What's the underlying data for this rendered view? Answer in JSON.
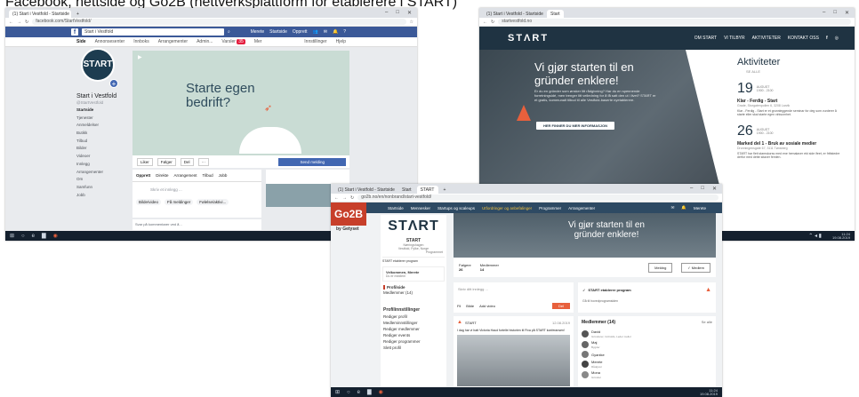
{
  "caption": "Facebook, nettside og Go2B (nettverksplattform for etablerere i START)",
  "fb": {
    "tab_title": "(1) Start i Vestfold - Startside",
    "url": "facebook.com/StartVestfold/",
    "search_value": "Start i Vestfold",
    "nav_right": [
      "Merete",
      "Startside",
      "Opprett"
    ],
    "tabs": [
      "Side",
      "Annonsesenter",
      "Innboks",
      "Arrangementer",
      "Admin...",
      "Varsler",
      "Mer"
    ],
    "tabs_right": [
      "Innstillinger",
      "Hjelp"
    ],
    "notif_count": "35",
    "page_name": "Start i Vestfold",
    "page_handle": "@StartVestfold",
    "profile_text": "STΛRT",
    "side_items": [
      "Startside",
      "Tjenester",
      "Anmeldelser",
      "Butikk",
      "Tilbud",
      "Bilder",
      "Videoer",
      "Innlegg",
      "Arrangementer",
      "Om",
      "Samfunn",
      "Jobb"
    ],
    "cover_title": "Starte egen bedrift?",
    "actions": [
      "Liker",
      "Følger",
      "Del"
    ],
    "send_msg": "Send melding",
    "composer": [
      "Opprett",
      "Direkte",
      "Arrangement",
      "Tilbud",
      "Jobb"
    ],
    "write_post": "Skriv et innlegg ...",
    "post_chips": [
      "Bilde/video",
      "Få meldinger",
      "Følelse/aktivi..."
    ],
    "reply_note": "Svar på kommentarer ved å..."
  },
  "start_web": {
    "tab_title": "Start",
    "url": "startvestfold.no",
    "logo": "STΛRT",
    "nav": [
      "OM START",
      "VI TILBYR",
      "AKTIVITETER",
      "KONTAKT OSS"
    ],
    "hero_title": "Vi gjør starten til en gründer enklere!",
    "hero_text": "Er du en gründer som ønsker litt rådgivning? Har du en spennende forretningsidé, men trenger litt veiledning for å få satt den ut i livet? START er et gratis, kommunalt tilbud til alle Vestfold-baserte nyetablerere.",
    "hero_button": "HER FINNER DU MER INFORMASJON",
    "activities_title": "Aktiviteter",
    "see_all": "SE ALLE",
    "events": [
      {
        "day": "19",
        "month": "AUGUST",
        "time": "1900 - 2100",
        "title": "Klar - Ferdig - Start",
        "place": "Grade, Storgatenpollen 6, 3208 Larvik",
        "desc": "Klar - Ferdig - Start er et grunnleggende seminar for deg som vurderer å starte eller skal starte egen virksomhet."
      },
      {
        "day": "26",
        "month": "AUGUST",
        "time": "1900 - 2100",
        "title": "Marked del 1 - Bruk av sosiale medier",
        "place": "Dronningensgate 67, 3111 Tønsberg",
        "desc": "START har fleit stamskorss med ene hemalaver ekt side ifeet, er frittstedre derfor med dette sitaver femlen."
      }
    ]
  },
  "go2b": {
    "tabs": [
      "(1) Start i Vestfold - Startside",
      "Start",
      "START"
    ],
    "url": "go2b.no/en/nonbrand/start-vestfold/",
    "nav": [
      "Startside",
      "Mennesker",
      "Startups og scaleups",
      "Utfordringer og anbefalinger",
      "Programmer",
      "Arrangementer"
    ],
    "user": "Merete",
    "logo_top": "Go2B",
    "logo_sub": "by Getyset",
    "start_logo": "STΛRT",
    "org_name": "START",
    "org_sub": "Næringshagen",
    "org_place": "Vestfold, Fylke, Norge",
    "org_role": "Programmet",
    "banner_title": "Vi gjør starten til en gründer enklere!",
    "stats": [
      {
        "label": "Følgere",
        "value": "26"
      },
      {
        "label": "Medlemmer",
        "value": "14"
      }
    ],
    "follow_btn": "Meldng",
    "member_btn": "Medlem",
    "program_label": "START etablerer program",
    "welcome_name": "Velkommen, Merete",
    "welcome_sub": "Du er medlem",
    "side_links": [
      "Profilside",
      "Medlemmer (14)"
    ],
    "settings_title": "Profilinnstillinger",
    "settings_items": [
      "Rediger profil",
      "Medleminnstillinger",
      "Rediger medlemmer",
      "Rediger events",
      "Rediger programmer",
      "Slett profil"
    ],
    "write_post": "Skriv ditt innlegg ...",
    "post_actions": [
      "Fil",
      "Bilde",
      "Add video"
    ],
    "post_button": "Del",
    "post_author": "START",
    "post_date": "12.08.2019",
    "post_text": "I dag har vi hatt Victoria Haud fortelle historien til Fiva på START konferansen!",
    "program_card": "START etablerer program",
    "see_program": "Gå til hovedprogramsiden",
    "members_title": "Medlemmer (14)",
    "members_all": "Se alle",
    "members": [
      {
        "name": "David",
        "sub": "Gründerer, Innholds, Leder mellor"
      },
      {
        "name": "Maj",
        "sub": "Bygder"
      },
      {
        "name": "Gyanike",
        "sub": ""
      },
      {
        "name": "Merete",
        "sub": "Rådgiver"
      },
      {
        "name": "Mona",
        "sub": "Gründer"
      }
    ]
  },
  "taskbar": {
    "time": "11:24",
    "date": "19.08.2019"
  },
  "colors": {
    "fb_blue": "#3b5998",
    "start_dark": "#1f3342",
    "start_orange": "#e8603c",
    "go2b_red": "#c73f2a",
    "go2b_nav": "#2e4a63"
  }
}
